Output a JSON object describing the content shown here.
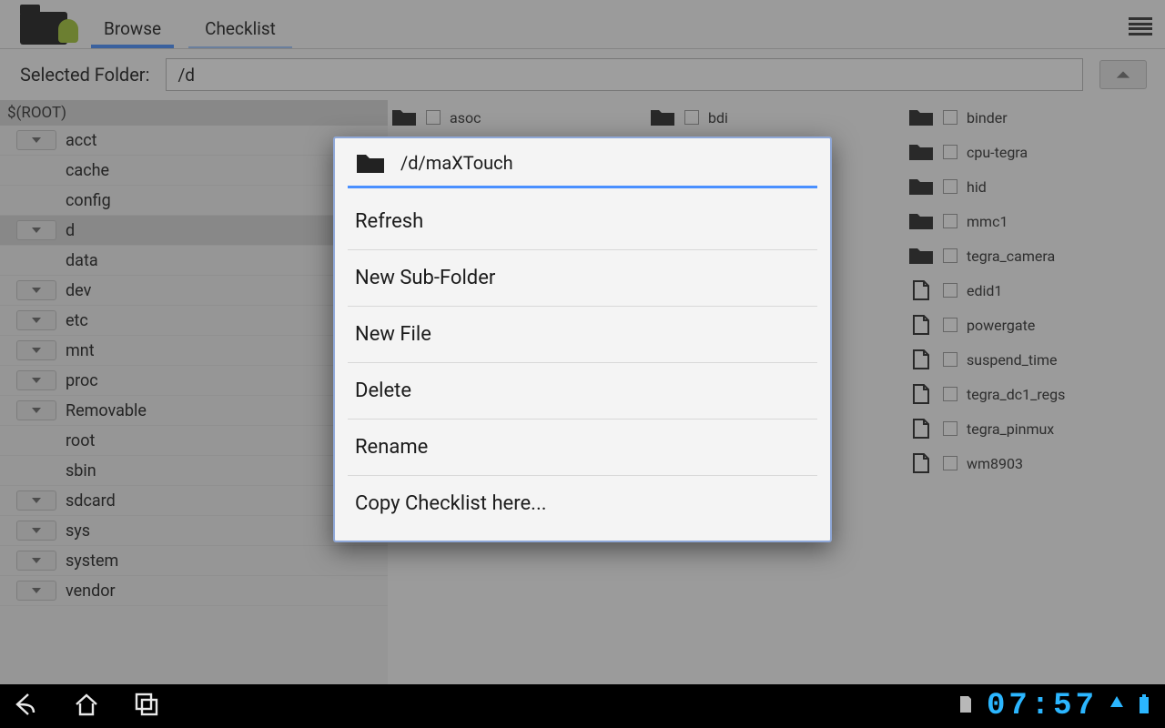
{
  "header": {
    "tabs": [
      "Browse",
      "Checklist"
    ],
    "active_tab_index": 0
  },
  "path": {
    "label": "Selected Folder:",
    "value": "/d"
  },
  "tree": {
    "root_label": "$(ROOT)",
    "items": [
      {
        "label": "acct",
        "expandable": true,
        "selected": false
      },
      {
        "label": "cache",
        "expandable": false,
        "selected": false
      },
      {
        "label": "config",
        "expandable": false,
        "selected": false
      },
      {
        "label": "d",
        "expandable": true,
        "selected": true
      },
      {
        "label": "data",
        "expandable": false,
        "selected": false
      },
      {
        "label": "dev",
        "expandable": true,
        "selected": false
      },
      {
        "label": "etc",
        "expandable": true,
        "selected": false
      },
      {
        "label": "mnt",
        "expandable": true,
        "selected": false
      },
      {
        "label": "proc",
        "expandable": true,
        "selected": false
      },
      {
        "label": "Removable",
        "expandable": true,
        "selected": false
      },
      {
        "label": "root",
        "expandable": false,
        "selected": false
      },
      {
        "label": "sbin",
        "expandable": false,
        "selected": false
      },
      {
        "label": "sdcard",
        "expandable": true,
        "selected": false
      },
      {
        "label": "sys",
        "expandable": true,
        "selected": false
      },
      {
        "label": "system",
        "expandable": true,
        "selected": false
      },
      {
        "label": "vendor",
        "expandable": true,
        "selected": false
      }
    ]
  },
  "grid": {
    "col1": [
      {
        "label": "asoc",
        "type": "folder"
      }
    ],
    "col2": [
      {
        "label": "bdi",
        "type": "folder"
      }
    ],
    "col3": [
      {
        "label": "binder",
        "type": "folder"
      },
      {
        "label": "cpu-tegra",
        "type": "folder"
      },
      {
        "label": "hid",
        "type": "folder"
      },
      {
        "label": "mmc1",
        "type": "folder"
      },
      {
        "label": "tegra_camera",
        "type": "folder"
      },
      {
        "label": "edid1",
        "type": "file"
      },
      {
        "label": "powergate",
        "type": "file"
      },
      {
        "label": "suspend_time",
        "type": "file"
      },
      {
        "label": "tegra_dc1_regs",
        "type": "file"
      },
      {
        "label": "tegra_pinmux",
        "type": "file"
      },
      {
        "label": "wm8903",
        "type": "file"
      }
    ]
  },
  "dialog": {
    "title": "/d/maXTouch",
    "items": [
      "Refresh",
      "New Sub-Folder",
      "New File",
      "Delete",
      "Rename",
      "Copy Checklist here..."
    ]
  },
  "statusbar": {
    "clock": "07:57"
  }
}
